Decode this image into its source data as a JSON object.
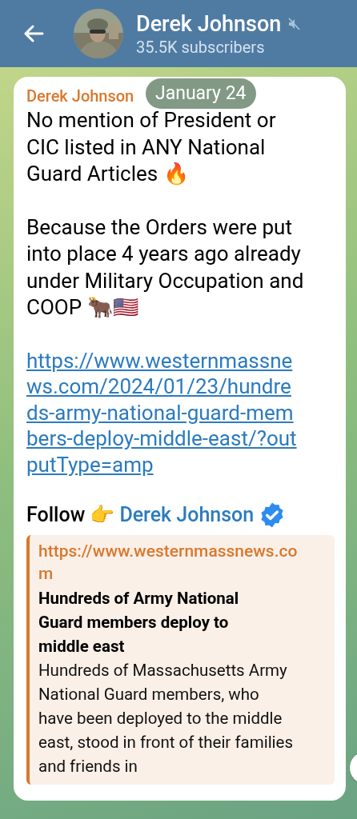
{
  "header": {
    "title": "Derek Johnson",
    "muted": true,
    "subtitle": "35.5K subscribers"
  },
  "date_pill": "January 24",
  "message": {
    "sender": "Derek Johnson",
    "paragraphs": [
      "No mention of President or CIC listed in ANY National Guard Articles 🔥",
      "Because the Orders were put into place 4 years ago already under Military Occupation and COOP 🐂🇺🇸"
    ],
    "link": "https://www.westernmassnews.com/2024/01/23/hundreds-army-national-guard-members-deploy-middle-east/?outputType=amp",
    "follow": {
      "text": "Follow 👉",
      "name": "Derek Johnson",
      "verified": true
    },
    "preview": {
      "site": "https://www.westernmassnews.com",
      "title": "Hundreds of Army National Guard members deploy to middle east",
      "description": "Hundreds of Massachusetts Army National Guard members, who have been deployed to the middle east, stood in front of their families and friends in"
    }
  }
}
